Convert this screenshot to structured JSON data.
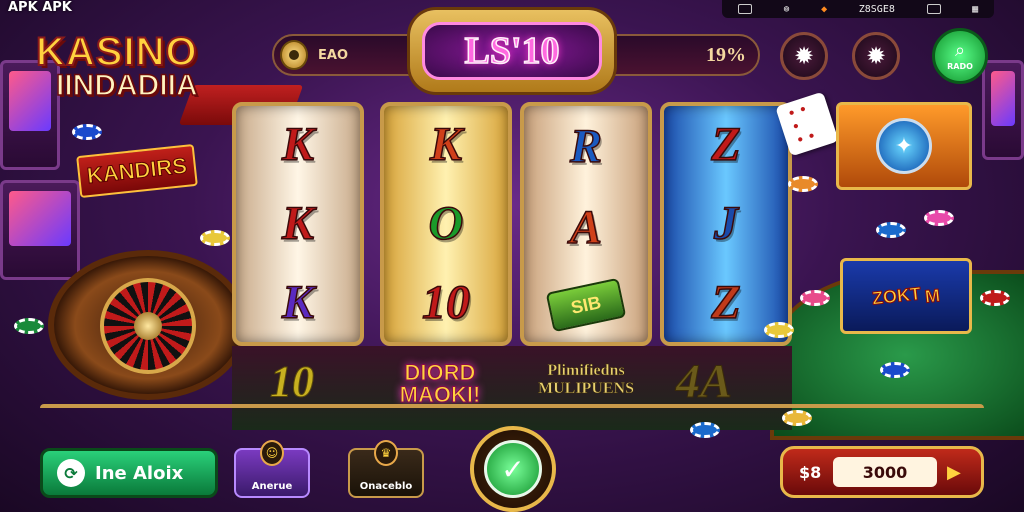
{
  "watermark": "APK APK",
  "status_bar": {
    "value": "Z8SGE8"
  },
  "logo": {
    "line1": "KASINO",
    "line2": "IINDADIIA"
  },
  "side_sign": "KANDIRS",
  "header": {
    "label": "EAO",
    "jackpot": "LS'10",
    "percent": "19%",
    "profile_label": "RADO"
  },
  "reels": [
    {
      "symbols": [
        "K",
        "K",
        "K"
      ],
      "colors": [
        "#c01a1a",
        "#c01a1a",
        "#5a2ac0"
      ],
      "display": [
        "K",
        "K",
        "K"
      ]
    },
    {
      "symbols": [
        "K",
        "O",
        "10"
      ],
      "colors": [
        "#d0401a",
        "#1a9a2a",
        "#c01a1a"
      ],
      "display": [
        "K",
        "O",
        "10"
      ]
    },
    {
      "symbols": [
        "R",
        "A",
        "SIB"
      ],
      "colors": [
        "#1a5ac0",
        "#d0401a",
        "#ffe870"
      ],
      "display": [
        "R",
        "A",
        "SIB"
      ]
    },
    {
      "symbols": [
        "Z",
        "J",
        "Z"
      ],
      "colors": [
        "#c01a1a",
        "#1a4aaa",
        "#c03a1a"
      ],
      "display": [
        "Z",
        "J",
        "Z"
      ]
    }
  ],
  "bonus": {
    "card2_tag1": "ZOKT",
    "card2_tag2": "M"
  },
  "lower": {
    "num": "10",
    "magic": "DIORD MAOKI!",
    "mult_line1": "Plimifiedns",
    "mult_line2": "MULIPUENS",
    "fourA": "4A"
  },
  "controls": {
    "auto_label": "Ine Aloix",
    "btn_a_label": "Anerue",
    "btn_b_label": "Onaceblo",
    "bet_symbol": "$8",
    "bet_value": "3000"
  }
}
